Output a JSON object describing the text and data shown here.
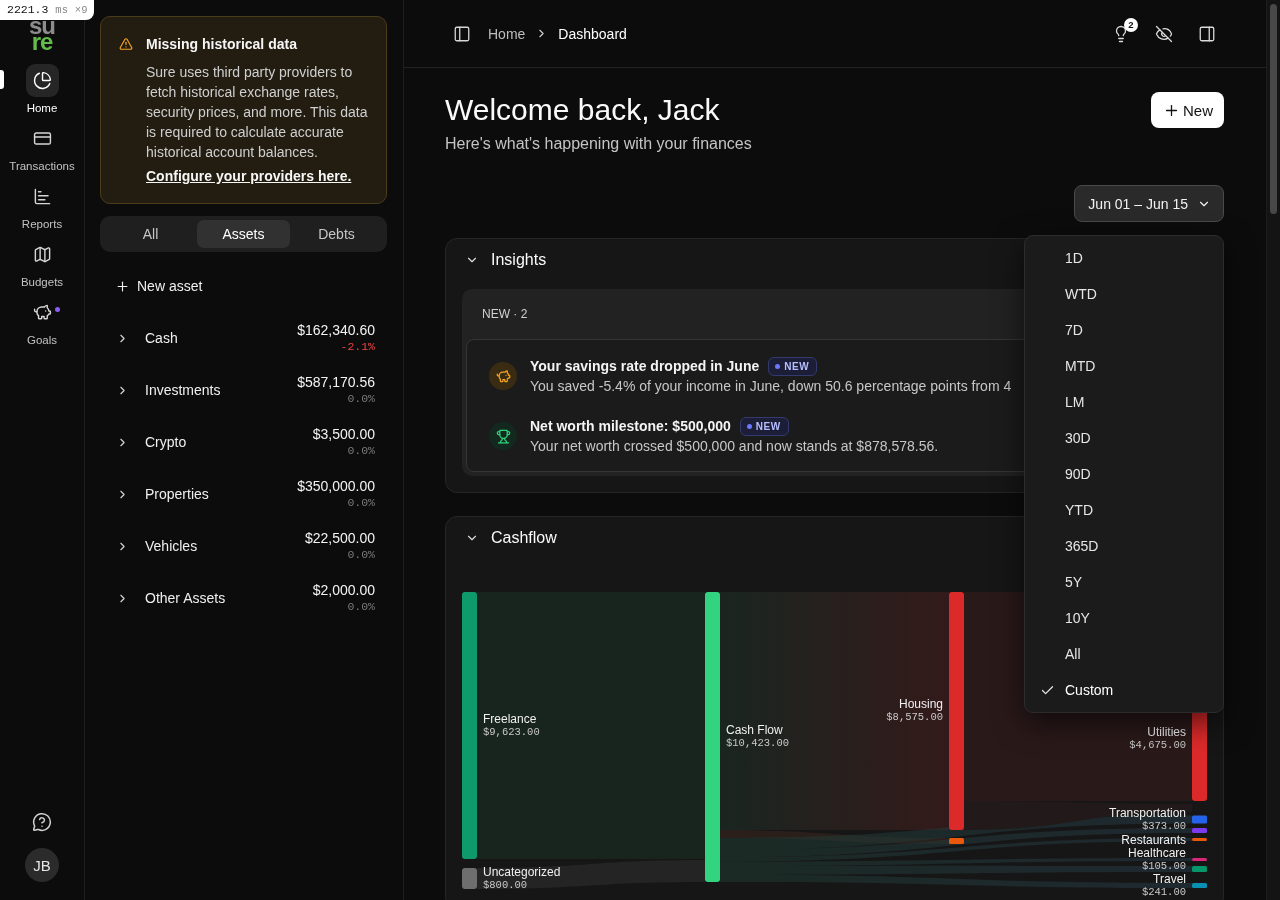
{
  "timer": {
    "value": "2221.3",
    "unit": "ms",
    "count": "×9"
  },
  "logo": {
    "top": "su",
    "bottom": "re"
  },
  "nav": {
    "items": [
      {
        "label": "Home",
        "selected": true,
        "notification": false
      },
      {
        "label": "Transactions",
        "selected": false,
        "notification": false
      },
      {
        "label": "Reports",
        "selected": false,
        "notification": false
      },
      {
        "label": "Budgets",
        "selected": false,
        "notification": false
      },
      {
        "label": "Goals",
        "selected": false,
        "notification": true
      }
    ],
    "avatar": "JB"
  },
  "alert": {
    "title": "Missing historical data",
    "message": "Sure uses third party providers to fetch historical exchange rates, security prices, and more. This data is required to calculate accurate historical account balances.",
    "link": "Configure your providers here."
  },
  "account_tabs": [
    {
      "label": "All",
      "selected": false
    },
    {
      "label": "Assets",
      "selected": true
    },
    {
      "label": "Debts",
      "selected": false
    }
  ],
  "new_account": "New asset",
  "accounts": [
    {
      "name": "Cash",
      "balance": "$162,340.60",
      "change": "-2.1%",
      "negative": true
    },
    {
      "name": "Investments",
      "balance": "$587,170.56",
      "change": "0.0%",
      "negative": false
    },
    {
      "name": "Crypto",
      "balance": "$3,500.00",
      "change": "0.0%",
      "negative": false
    },
    {
      "name": "Properties",
      "balance": "$350,000.00",
      "change": "0.0%",
      "negative": false
    },
    {
      "name": "Vehicles",
      "balance": "$22,500.00",
      "change": "0.0%",
      "negative": false
    },
    {
      "name": "Other Assets",
      "balance": "$2,000.00",
      "change": "0.0%",
      "negative": false
    }
  ],
  "breadcrumb": [
    {
      "label": "Home",
      "current": false
    },
    {
      "label": "Dashboard",
      "current": true
    }
  ],
  "insights_count": "2",
  "welcome": {
    "title": "Welcome back, Jack",
    "subtitle": "Here's what's happening with your finances"
  },
  "new_button": "New",
  "period": {
    "value": "Jun 01 – Jun 15",
    "expanded": true,
    "options": [
      {
        "label": "1D",
        "selected": false
      },
      {
        "label": "WTD",
        "selected": false
      },
      {
        "label": "7D",
        "selected": false
      },
      {
        "label": "MTD",
        "selected": false
      },
      {
        "label": "LM",
        "selected": false
      },
      {
        "label": "30D",
        "selected": false
      },
      {
        "label": "90D",
        "selected": false
      },
      {
        "label": "YTD",
        "selected": false
      },
      {
        "label": "365D",
        "selected": false
      },
      {
        "label": "5Y",
        "selected": false
      },
      {
        "label": "10Y",
        "selected": false
      },
      {
        "label": "All",
        "selected": false
      },
      {
        "label": "Custom",
        "selected": true
      }
    ]
  },
  "insights": {
    "title": "Insights",
    "expanded": true,
    "group_label": "NEW · 2",
    "items": [
      {
        "kind": "savings",
        "title": "Your savings rate dropped in June",
        "badge": "NEW",
        "description": "You saved -5.4% of your income in June, down 50.6 percentage points from 4"
      },
      {
        "kind": "milestone",
        "title": "Net worth milestone: $500,000",
        "badge": "NEW",
        "description": "Your net worth crossed $500,000 and now stands at $878,578.56."
      }
    ]
  },
  "cashflow": {
    "title": "Cashflow",
    "expanded": true,
    "sankey": {
      "columns": [
        {
          "nodes": [
            {
              "label": "Freelance",
              "amount": "$9,623.00",
              "color": "#0e9a6a"
            },
            {
              "label": "Uncategorized",
              "amount": "$800.00",
              "color": "#6e6e6e"
            }
          ]
        },
        {
          "nodes": [
            {
              "label": "Cash Flow",
              "amount": "$10,423.00",
              "color": "#33d47f"
            }
          ]
        },
        {
          "nodes": [
            {
              "label": "Housing",
              "amount": "$8,575.00",
              "color": "#dc2a2a"
            },
            {
              "color": "#ea580c"
            }
          ]
        },
        {
          "nodes": [
            {
              "label": "Utilities",
              "amount": "$4,675.00",
              "color": "#dc2a2a"
            },
            {
              "label": "Transportation",
              "amount": "$373.00",
              "color": "#2563eb"
            },
            {
              "color": "#7c3aed"
            },
            {
              "label": "Restaurants",
              "color": "#ea580c"
            },
            {
              "label": "Healthcare",
              "amount": "$105.00",
              "color": "#db2777"
            },
            {
              "color": "#059669"
            },
            {
              "label": "Travel",
              "amount": "$241.00",
              "color": "#0891b2"
            }
          ]
        }
      ]
    }
  }
}
